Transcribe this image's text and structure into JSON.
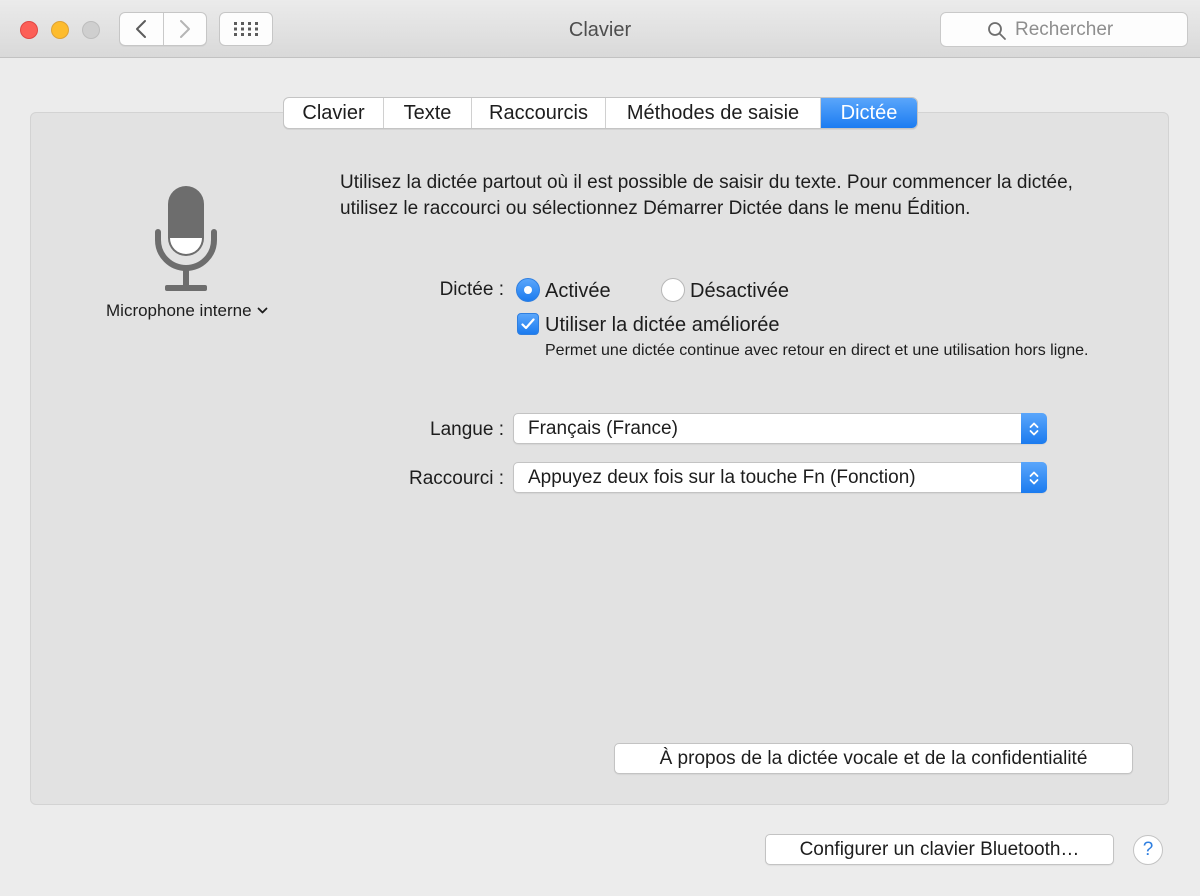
{
  "window": {
    "title": "Clavier",
    "search_placeholder": "Rechercher"
  },
  "toolbar": {
    "back_icon": "chevron-left-icon",
    "forward_icon": "chevron-right-icon",
    "show_all_icon": "grid-icon"
  },
  "tabs": [
    {
      "label": "Clavier",
      "active": false
    },
    {
      "label": "Texte",
      "active": false
    },
    {
      "label": "Raccourcis",
      "active": false
    },
    {
      "label": "Méthodes de saisie",
      "active": false
    },
    {
      "label": "Dictée",
      "active": true
    }
  ],
  "dictation": {
    "microphone_source": "Microphone interne",
    "intro": "Utilisez la dictée partout où il est possible de saisir du texte. Pour commencer la dictée, utilisez le raccourci ou sélectionnez Démarrer Dictée dans le menu Édition.",
    "dictation_label": "Dictée :",
    "option_on": "Activée",
    "option_off": "Désactivée",
    "selected_option": "Activée",
    "enhanced_label": "Utiliser la dictée améliorée",
    "enhanced_checked": true,
    "enhanced_description": "Permet une dictée continue avec retour en direct et une utilisation hors ligne.",
    "language_label": "Langue :",
    "language_value": "Français (France)",
    "shortcut_label": "Raccourci :",
    "shortcut_value": "Appuyez deux fois sur la touche Fn (Fonction)",
    "about_button": "À propos de la dictée vocale et de la confidentialité"
  },
  "footer": {
    "bluetooth_button": "Configurer un clavier Bluetooth…",
    "help_button": "?"
  },
  "colors": {
    "accent": "#1c7cf1",
    "window_bg": "#ececec",
    "panel_bg": "#e2e2e2",
    "close": "#fc5f57",
    "minimize": "#fdbc2e"
  }
}
